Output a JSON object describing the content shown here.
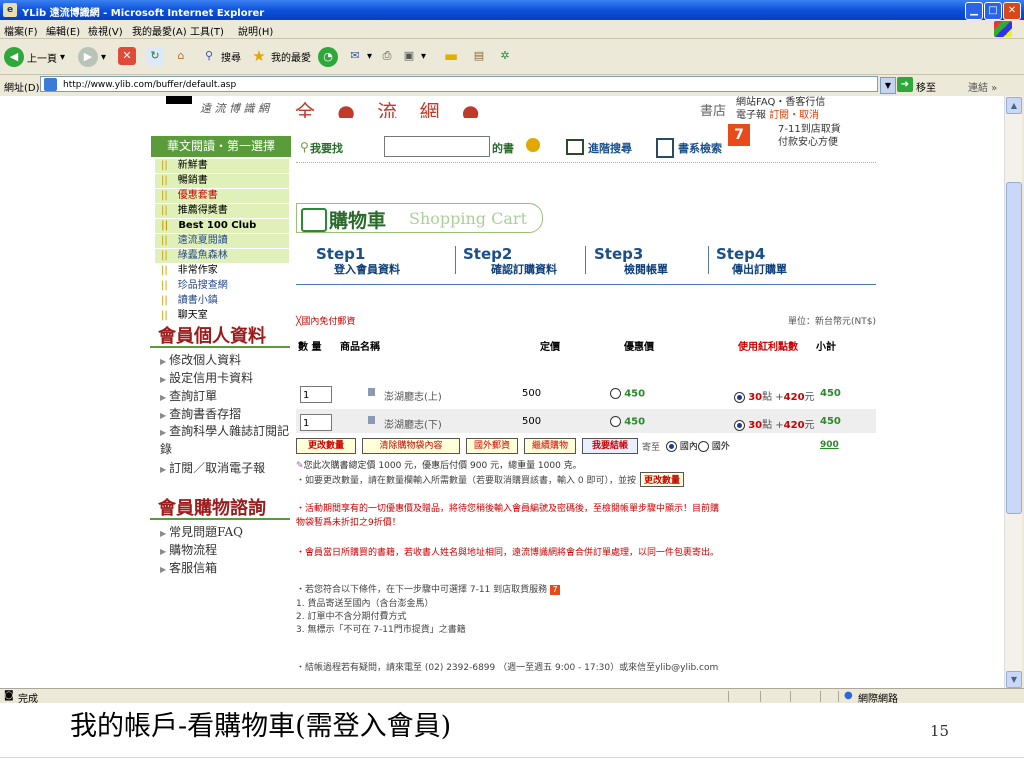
{
  "window": {
    "title": "YLib 遠流博識網 - Microsoft Internet Explorer",
    "minimize": "▁",
    "maximize": "□",
    "close": "✕"
  },
  "menu": [
    "檔案(F)",
    "編輯(E)",
    "檢視(V)",
    "我的最愛(A)",
    "工具(T)",
    "說明(H)"
  ],
  "toolbar": {
    "back": "上一頁",
    "search": "搜尋",
    "favorites": "我的最愛"
  },
  "address": {
    "label": "網址(D)",
    "url": "http://www.ylib.com/buffer/default.asp",
    "go": "移至",
    "links": "連結 »"
  },
  "site": {
    "logo_text": "遠 流 博 識 網",
    "banner": "全 ● 流 網 ● 站",
    "store": "書店",
    "top_links": [
      "網站FAQ・香客行信",
      "電子報",
      "訂閱・取消",
      "7-11到店取貨",
      "付款安心方便"
    ]
  },
  "sidebar": {
    "header": "華文閱讀・第一選擇",
    "items": [
      "新鮮書",
      "暢銷書",
      "優惠套書",
      "推薦得獎書",
      "Best 100 Club",
      "遠流夏閱讀",
      "綠蠹魚森林",
      "非常作家",
      "珍品搜查網",
      "讀書小鎮",
      "聊天室"
    ],
    "member_title": "會員個人資料",
    "member_links": [
      "修改個人資料",
      "設定信用卡資料",
      "查詢訂單",
      "查詢書香存摺",
      "查詢科學人雜誌訂閱記錄",
      "訂閱／取消電子報"
    ],
    "consult_title": "會員購物諮詢",
    "consult_links": [
      "常見問題FAQ",
      "購物流程",
      "客服信箱"
    ]
  },
  "search": {
    "prefix": "我要找",
    "suffix": "的書",
    "advanced": "進階搜尋",
    "catalog": "書系檢索"
  },
  "cart": {
    "title": "購物車",
    "title_en": "Shopping Cart"
  },
  "steps": [
    {
      "label": "Step",
      "num": "1",
      "sub": "登入會員資料"
    },
    {
      "label": "Step",
      "num": "2",
      "sub": "確認訂購資料"
    },
    {
      "label": "Step",
      "num": "3",
      "sub": "檢閱帳單"
    },
    {
      "label": "Step",
      "num": "4",
      "sub": "傳出訂購單"
    }
  ],
  "table": {
    "free_ship": "╳國內免付郵資",
    "currency": "單位：新台幣元(NT$)",
    "headers": {
      "qty": "數 量",
      "name": "商品名稱",
      "price": "定價",
      "discount": "優惠價",
      "points": "使用紅利點數",
      "subtotal": "小計"
    },
    "rows": [
      {
        "qty": "1",
        "name": "澎湖廳志(上)",
        "price": "500",
        "disc": "450",
        "pts": "30",
        "pts_unit": "點 +",
        "cash": "420",
        "cash_unit": "元",
        "subtotal": "450"
      },
      {
        "qty": "1",
        "name": "澎湖廳志(下)",
        "price": "500",
        "disc": "450",
        "pts": "30",
        "pts_unit": "點 +",
        "cash": "420",
        "cash_unit": "元",
        "subtotal": "450"
      }
    ]
  },
  "buttons": {
    "update": "更改數量",
    "clear": "清除購物袋內容",
    "overseas": "國外郵資",
    "continue": "繼續購物",
    "checkout": "我要結帳",
    "ship_to": "寄至",
    "domestic": "國內",
    "abroad": "國外",
    "total": "900"
  },
  "notes": {
    "summary": "您此次購書總定價 1000 元，優惠后付價 900 元，總重量 1000 克。",
    "qty_hint": "・如要更改數量，請在數量欄輸入所需數量（若要取消購買該書，輸入 0 即可），並按",
    "qty_btn": "更改數量",
    "promo": "・活動期間享有的一切優惠價及贈品，將待您稍後輸入會員編號及密碼後，至檢閱帳單步驟中顯示！目前購",
    "promo2": "物袋暫爲未折扣之9折價！",
    "merge": "・會員當日所購買的書籍，若收書人姓名與地址相同，遠流博識網將會合併訂單處理，以同一件包裹寄出。",
    "seven": "・若您符合以下條件，在下一步驟中可選擇 7-11 到店取貨服務",
    "cond1": "1. 貨品寄送至國內（含台澎金馬）",
    "cond2": "2. 訂單中不含分期付費方式",
    "cond3": "3. 無標示「不可在 7-11門市提貨」之書籍",
    "contact": "・結帳過程若有疑問，請來電至 (02) 2392-6899 （週一至週五 9:00 - 17:30）或來信至ylib@ylib.com"
  },
  "status": {
    "left": "完成",
    "right": "網際網路"
  },
  "slide": {
    "caption": "我的帳戶-看購物車(需登入會員)",
    "page": "15"
  }
}
